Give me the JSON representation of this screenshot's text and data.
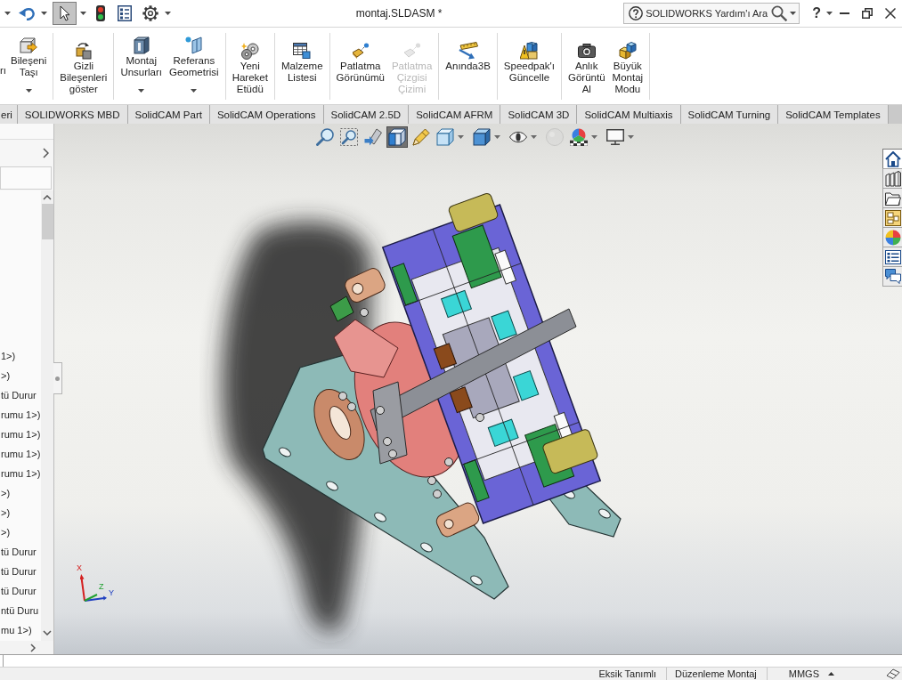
{
  "window": {
    "title": "montaj.SLDASM *"
  },
  "quick_access": [
    {
      "dropdown": true,
      "pressed": false
    },
    {
      "dropdown": true,
      "pressed": true
    },
    {
      "dropdown": false,
      "pressed": false
    },
    {
      "dropdown": false,
      "pressed": false
    },
    {
      "dropdown": true,
      "pressed": false
    }
  ],
  "help_search": {
    "placeholder": "SOLIDWORKS Yardım'ı Ara"
  },
  "help_button": {
    "label": "?"
  },
  "ribbon": {
    "groups": [
      {
        "items": [
          {
            "kind": "partial",
            "label": "rı",
            "dropdown": false,
            "disabled": false
          },
          {
            "kind": "button",
            "label": "Bileşeni\nTaşı",
            "dropdown": true,
            "disabled": false
          }
        ]
      },
      {
        "items": [
          {
            "kind": "button",
            "label": "Gizli\nBileşenleri\ngöster",
            "dropdown": false,
            "disabled": false
          }
        ]
      },
      {
        "items": [
          {
            "kind": "button",
            "label": "Montaj\nUnsurları",
            "dropdown": true,
            "disabled": false
          },
          {
            "kind": "button",
            "label": "Referans\nGeometrisi",
            "dropdown": true,
            "disabled": false
          }
        ]
      },
      {
        "items": [
          {
            "kind": "button",
            "label": "Yeni\nHareket\nEtüdü",
            "dropdown": false,
            "disabled": false
          }
        ]
      },
      {
        "items": [
          {
            "kind": "button",
            "label": "Malzeme\nListesi",
            "dropdown": false,
            "disabled": false
          }
        ]
      },
      {
        "items": [
          {
            "kind": "button",
            "label": "Patlatma\nGörünümü",
            "dropdown": false,
            "disabled": false
          },
          {
            "kind": "button",
            "label": "Patlatma\nÇizgisi\nÇizimi",
            "dropdown": false,
            "disabled": true
          }
        ]
      },
      {
        "items": [
          {
            "kind": "button",
            "label": "Anında3B",
            "dropdown": false,
            "disabled": false
          }
        ]
      },
      {
        "items": [
          {
            "kind": "button",
            "label": "Speedpak'ı\nGüncelle",
            "dropdown": false,
            "disabled": false
          }
        ]
      },
      {
        "items": [
          {
            "kind": "button",
            "label": "Anlık\nGörüntü\nAl",
            "dropdown": false,
            "disabled": false
          },
          {
            "kind": "button",
            "label": "Büyük\nMontaj\nModu",
            "dropdown": false,
            "disabled": false
          }
        ]
      }
    ]
  },
  "tabs": [
    {
      "label": "eri",
      "selected": false
    },
    {
      "label": "SOLIDWORKS MBD",
      "selected": false
    },
    {
      "label": "SolidCAM Part",
      "selected": false
    },
    {
      "label": "SolidCAM Operations",
      "selected": false
    },
    {
      "label": "SolidCAM 2.5D",
      "selected": false
    },
    {
      "label": "SolidCAM AFRM",
      "selected": false
    },
    {
      "label": "SolidCAM 3D",
      "selected": false
    },
    {
      "label": "SolidCAM Multiaxis",
      "selected": false
    },
    {
      "label": "SolidCAM Turning",
      "selected": false
    },
    {
      "label": "SolidCAM Templates",
      "selected": false
    }
  ],
  "feature_tree": {
    "rows": [
      {
        "label": "1>)",
        "selected": false
      },
      {
        "label": ">)",
        "selected": false
      },
      {
        "label": "tü Durur",
        "selected": false
      },
      {
        "label": "rumu 1>)",
        "selected": false
      },
      {
        "label": "rumu 1>)",
        "selected": false
      },
      {
        "label": "rumu 1>)",
        "selected": false
      },
      {
        "label": "rumu 1>)",
        "selected": false
      },
      {
        "label": ">)",
        "selected": false
      },
      {
        "label": ">)",
        "selected": false
      },
      {
        "label": ">)",
        "selected": false
      },
      {
        "label": "tü Durur",
        "selected": false
      },
      {
        "label": "tü Durur",
        "selected": false
      },
      {
        "label": "tü Durur",
        "selected": false
      },
      {
        "label": "ntü Duru",
        "selected": false
      },
      {
        "label": "mu 1>)",
        "selected": false
      }
    ]
  },
  "view_toolbar": [
    {
      "pressed": false,
      "dropdown": false,
      "disabled": false
    },
    {
      "pressed": false,
      "dropdown": false,
      "disabled": false
    },
    {
      "pressed": false,
      "dropdown": false,
      "disabled": false
    },
    {
      "pressed": true,
      "dropdown": false,
      "disabled": false
    },
    {
      "pressed": false,
      "dropdown": false,
      "disabled": false
    },
    {
      "pressed": false,
      "dropdown": true,
      "disabled": false
    },
    {
      "pressed": false,
      "dropdown": true,
      "disabled": false
    },
    {
      "pressed": false,
      "dropdown": true,
      "disabled": false
    },
    {
      "pressed": false,
      "dropdown": false,
      "disabled": true
    },
    {
      "pressed": false,
      "dropdown": true,
      "disabled": false
    },
    {
      "pressed": false,
      "dropdown": true,
      "disabled": false
    }
  ],
  "task_pane": [
    {
      "selected": true
    },
    {
      "selected": false
    },
    {
      "selected": false
    },
    {
      "selected": false
    },
    {
      "selected": false
    },
    {
      "selected": false
    },
    {
      "selected": false
    }
  ],
  "triad": {
    "x_label": "X",
    "y_label": "Y",
    "z_label": "Z"
  },
  "status_bar": {
    "items": [
      {
        "label": "Eksik Tanımlı",
        "dropdown": false
      },
      {
        "label": "Düzenleme Montaj",
        "dropdown": false
      },
      {
        "label": "MMGS",
        "dropdown": true
      }
    ]
  }
}
